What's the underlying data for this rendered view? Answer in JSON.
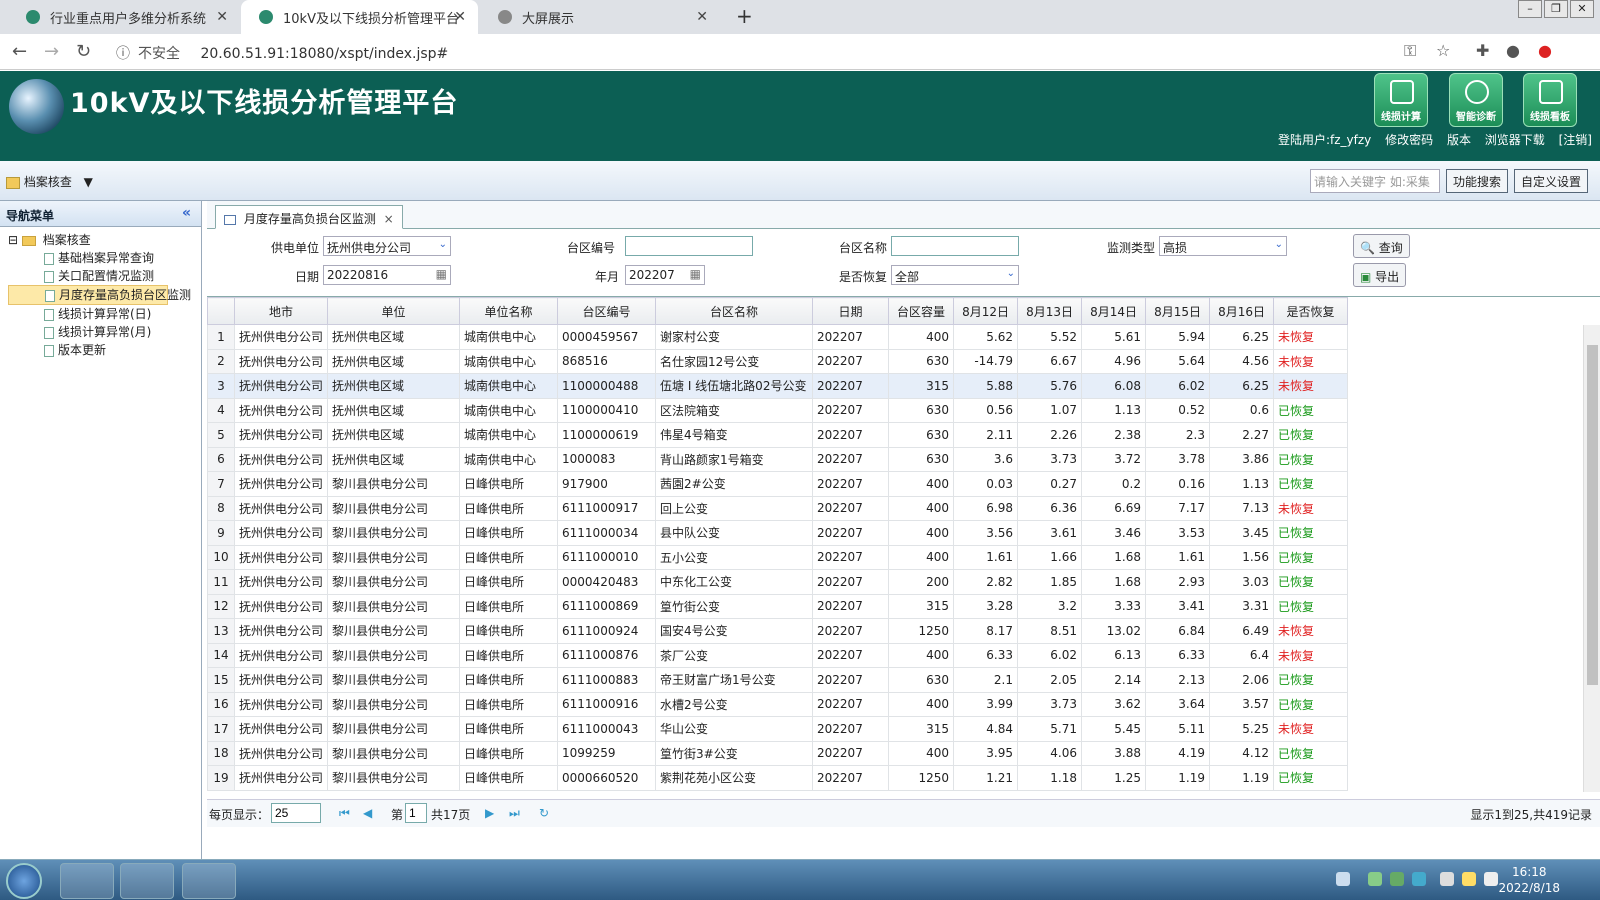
{
  "browser": {
    "tabs": [
      {
        "title": "行业重点用户多维分析系统",
        "active": false
      },
      {
        "title": "10kV及以下线损分析管理平台",
        "active": true
      },
      {
        "title": "大屏展示",
        "active": false
      }
    ],
    "insecure_label": "不安全",
    "url": "20.60.51.91:18080/xspt/index.jsp#"
  },
  "header": {
    "title": "10kV及以下线损分析管理平台",
    "buttons": [
      "线损计算",
      "智能诊断",
      "线损看板"
    ],
    "user_label": "登陆用户:fz_yfzy",
    "links": [
      "修改密码",
      "版本",
      "浏览器下载",
      "[注销]"
    ]
  },
  "toolbar": {
    "menu_label": "档案核查",
    "search_placeholder": "请输入关键字 如:采集",
    "func_search": "功能搜索",
    "custom_settings": "自定义设置"
  },
  "sidebar": {
    "title": "导航菜单",
    "root": "档案核查",
    "items": [
      "基础档案异常查询",
      "关口配置情况监测",
      "月度存量高负损台区监测",
      "线损计算异常(日)",
      "线损计算异常(月)",
      "版本更新"
    ],
    "selected_index": 2
  },
  "page_tab": "月度存量高负损台区监测",
  "form": {
    "supply_unit_label": "供电单位",
    "supply_unit_value": "抚州供电分公司",
    "area_code_label": "台区编号",
    "area_name_label": "台区名称",
    "monitor_type_label": "监测类型",
    "monitor_type_value": "高损",
    "query_button": "查询",
    "date_label": "日期",
    "date_value": "20220816",
    "month_label": "年月",
    "month_value": "202207",
    "recovered_label": "是否恢复",
    "recovered_value": "全部",
    "export_button": "导出"
  },
  "grid": {
    "columns": [
      "",
      "地市",
      "单位",
      "单位名称",
      "台区编号",
      "台区名称",
      "日期",
      "台区容量",
      "8月12日",
      "8月13日",
      "8月14日",
      "8月15日",
      "8月16日",
      "是否恢复"
    ],
    "rows": [
      [
        "1",
        "抚州供电分公司",
        "抚州供电区域",
        "城南供电中心",
        "0000459567",
        "谢家村公变",
        "202207",
        "400",
        "5.62",
        "5.52",
        "5.61",
        "5.94",
        "6.25",
        "未恢复"
      ],
      [
        "2",
        "抚州供电分公司",
        "抚州供电区域",
        "城南供电中心",
        "868516",
        "名仕家园12号公变",
        "202207",
        "630",
        "-14.79",
        "6.67",
        "4.96",
        "5.64",
        "4.56",
        "未恢复"
      ],
      [
        "3",
        "抚州供电分公司",
        "抚州供电区域",
        "城南供电中心",
        "1100000488",
        "伍塘 I 线伍塘北路02号公变",
        "202207",
        "315",
        "5.88",
        "5.76",
        "6.08",
        "6.02",
        "6.25",
        "未恢复"
      ],
      [
        "4",
        "抚州供电分公司",
        "抚州供电区域",
        "城南供电中心",
        "1100000410",
        "区法院箱变",
        "202207",
        "630",
        "0.56",
        "1.07",
        "1.13",
        "0.52",
        "0.6",
        "已恢复"
      ],
      [
        "5",
        "抚州供电分公司",
        "抚州供电区域",
        "城南供电中心",
        "1100000619",
        "伟星4号箱变",
        "202207",
        "630",
        "2.11",
        "2.26",
        "2.38",
        "2.3",
        "2.27",
        "已恢复"
      ],
      [
        "6",
        "抚州供电分公司",
        "抚州供电区域",
        "城南供电中心",
        "1000083",
        "背山路颜家1号箱变",
        "202207",
        "630",
        "3.6",
        "3.73",
        "3.72",
        "3.78",
        "3.86",
        "已恢复"
      ],
      [
        "7",
        "抚州供电分公司",
        "黎川县供电分公司",
        "日峰供电所",
        "917900",
        "茜園2#公变",
        "202207",
        "400",
        "0.03",
        "0.27",
        "0.2",
        "0.16",
        "1.13",
        "已恢复"
      ],
      [
        "8",
        "抚州供电分公司",
        "黎川县供电分公司",
        "日峰供电所",
        "6111000917",
        "回上公变",
        "202207",
        "400",
        "6.98",
        "6.36",
        "6.69",
        "7.17",
        "7.13",
        "未恢复"
      ],
      [
        "9",
        "抚州供电分公司",
        "黎川县供电分公司",
        "日峰供电所",
        "6111000034",
        "县中队公变",
        "202207",
        "400",
        "3.56",
        "3.61",
        "3.46",
        "3.53",
        "3.45",
        "已恢复"
      ],
      [
        "10",
        "抚州供电分公司",
        "黎川县供电分公司",
        "日峰供电所",
        "6111000010",
        "五小公变",
        "202207",
        "400",
        "1.61",
        "1.66",
        "1.68",
        "1.61",
        "1.56",
        "已恢复"
      ],
      [
        "11",
        "抚州供电分公司",
        "黎川县供电分公司",
        "日峰供电所",
        "0000420483",
        "中东化工公变",
        "202207",
        "200",
        "2.82",
        "1.85",
        "1.68",
        "2.93",
        "3.03",
        "已恢复"
      ],
      [
        "12",
        "抚州供电分公司",
        "黎川县供电分公司",
        "日峰供电所",
        "6111000869",
        "篁竹街公变",
        "202207",
        "315",
        "3.28",
        "3.2",
        "3.33",
        "3.41",
        "3.31",
        "已恢复"
      ],
      [
        "13",
        "抚州供电分公司",
        "黎川县供电分公司",
        "日峰供电所",
        "6111000924",
        "国安4号公变",
        "202207",
        "1250",
        "8.17",
        "8.51",
        "13.02",
        "6.84",
        "6.49",
        "未恢复"
      ],
      [
        "14",
        "抚州供电分公司",
        "黎川县供电分公司",
        "日峰供电所",
        "6111000876",
        "茶厂公变",
        "202207",
        "400",
        "6.33",
        "6.02",
        "6.13",
        "6.33",
        "6.4",
        "未恢复"
      ],
      [
        "15",
        "抚州供电分公司",
        "黎川县供电分公司",
        "日峰供电所",
        "6111000883",
        "帝王财富广场1号公变",
        "202207",
        "630",
        "2.1",
        "2.05",
        "2.14",
        "2.13",
        "2.06",
        "已恢复"
      ],
      [
        "16",
        "抚州供电分公司",
        "黎川县供电分公司",
        "日峰供电所",
        "6111000916",
        "水槽2号公变",
        "202207",
        "400",
        "3.99",
        "3.73",
        "3.62",
        "3.64",
        "3.57",
        "已恢复"
      ],
      [
        "17",
        "抚州供电分公司",
        "黎川县供电分公司",
        "日峰供电所",
        "6111000043",
        "华山公变",
        "202207",
        "315",
        "4.84",
        "5.71",
        "5.45",
        "5.11",
        "5.25",
        "未恢复"
      ],
      [
        "18",
        "抚州供电分公司",
        "黎川县供电分公司",
        "日峰供电所",
        "1099259",
        "篁竹街3#公变",
        "202207",
        "400",
        "3.95",
        "4.06",
        "3.88",
        "4.19",
        "4.12",
        "已恢复"
      ],
      [
        "19",
        "抚州供电分公司",
        "黎川县供电分公司",
        "日峰供电所",
        "0000660520",
        "紫荆花苑小区公变",
        "202207",
        "1250",
        "1.21",
        "1.18",
        "1.25",
        "1.19",
        "1.19",
        "已恢复"
      ]
    ],
    "highlight_row": 2
  },
  "pager": {
    "per_page_label": "每页显示：",
    "per_page_value": "25",
    "page_prefix": "第",
    "page_value": "1",
    "total_pages": "共17页",
    "summary": "显示1到25,共419记录"
  },
  "taskbar": {
    "time": "16:18",
    "date": "2022/8/18"
  },
  "colors": {
    "header_bg": "#0c5f54",
    "not_recovered": "#e02020",
    "recovered": "#1a9a1a"
  }
}
